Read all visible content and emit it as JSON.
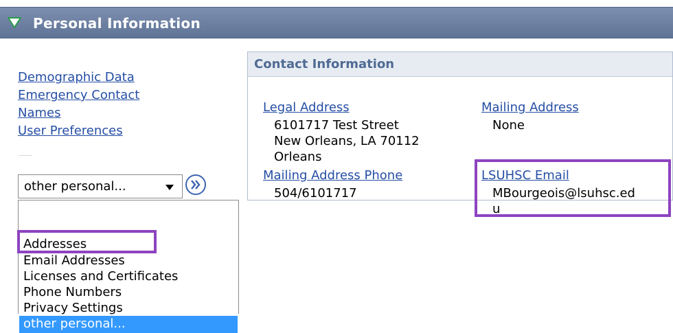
{
  "header": {
    "title": "Personal Information"
  },
  "left_nav": {
    "links": [
      "Demographic Data",
      "Emergency Contact",
      "Names",
      "User Preferences"
    ]
  },
  "select": {
    "value": "other personal...",
    "options": [
      "Addresses",
      "Email Addresses",
      "Licenses and Certificates",
      "Phone Numbers",
      "Privacy Settings",
      "other personal..."
    ],
    "selected_index": 5,
    "highlight_color": "#3399ff"
  },
  "contact": {
    "title": "Contact Information",
    "legal_address_label": "Legal Address",
    "legal_address_lines": [
      "6101717 Test Street",
      "New Orleans, LA 70112",
      "Orleans"
    ],
    "mailing_address_label": "Mailing Address",
    "mailing_address_value": "None",
    "mailing_phone_label": "Mailing Address Phone",
    "mailing_phone_value": "504/6101717",
    "email_label": "LSUHSC Email",
    "email_value_lines": [
      "MBourgeois@lsuhsc.ed",
      "u"
    ]
  },
  "colors": {
    "header_bg": "#6b7fa3",
    "link": "#254ea4",
    "annotation_box": "#8d44c0",
    "panel_title": "#506a93"
  },
  "icons": {
    "header_toggle": "triangle-down-icon",
    "go_button": "double-chevron-right-icon",
    "select_caret": "caret-down-icon"
  }
}
